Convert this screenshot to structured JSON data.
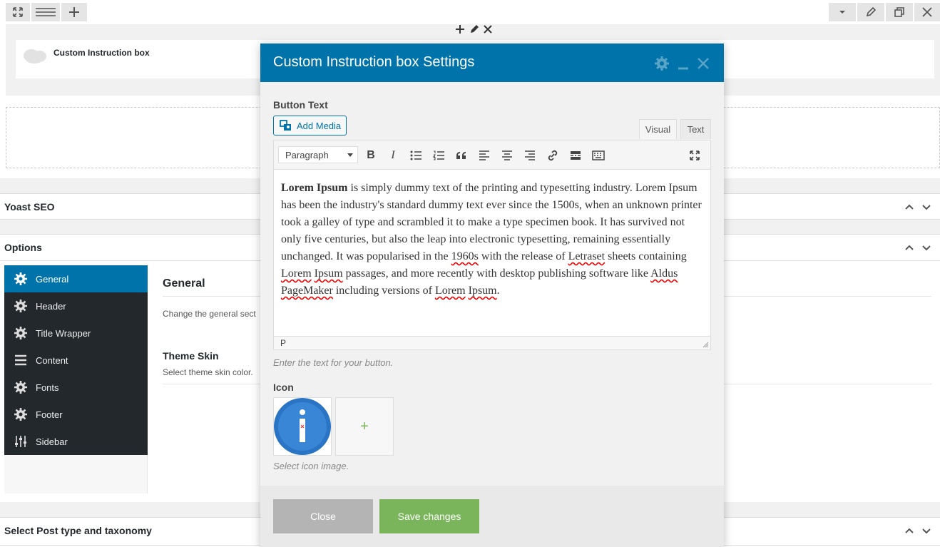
{
  "top_toolbar": {
    "left_buttons": [
      "expand-icon",
      "menu-icon",
      "plus-icon"
    ],
    "right_buttons": [
      "chevron-down-icon",
      "pencil-icon",
      "clone-icon",
      "close-icon"
    ]
  },
  "element": {
    "title": "Custom Instruction box"
  },
  "postboxes": {
    "yoast": "Yoast SEO",
    "options": "Options",
    "taxonomy": "Select Post type and taxonomy"
  },
  "options_panel": {
    "menu": [
      {
        "label": "General",
        "icon": "gear-icon",
        "active": true
      },
      {
        "label": "Header",
        "icon": "gear-icon"
      },
      {
        "label": "Title Wrapper",
        "icon": "gear-icon"
      },
      {
        "label": "Content",
        "icon": "list-icon"
      },
      {
        "label": "Fonts",
        "icon": "gear-icon"
      },
      {
        "label": "Footer",
        "icon": "gear-icon"
      },
      {
        "label": "Sidebar",
        "icon": "sliders-icon"
      }
    ],
    "section_title": "General",
    "section_desc": "Change the general sect",
    "skin_title": "Theme Skin",
    "skin_desc": "Select theme skin color."
  },
  "modal": {
    "title": "Custom Instruction box Settings",
    "button_text_label": "Button Text",
    "add_media": "Add Media",
    "tab_visual": "Visual",
    "tab_text": "Text",
    "format_select": "Paragraph",
    "editor": {
      "bold_lead": "Lorem Ipsum",
      "line1": " is simply dummy text of the printing and typesetting industry. Lorem Ipsum has been the industry's standard dummy text ever since the 1500s, when an unknown printer took a galley of type and scrambled it to make a type specimen book. It has survived not only five centuries, but also the leap into electronic typesetting, remaining essentially unchanged. It was popularised in the ",
      "w1960s": "1960s",
      "seg2": " with the release of ",
      "letraset": "Letraset",
      "seg3": " sheets containing ",
      "lorem1": "Lorem",
      "sp1": " ",
      "ipsum1": "Ipsum",
      "seg4": " passages, and more recently with desktop publishing software like ",
      "aldus": "Aldus",
      "sp2": " ",
      "pagemaker": "PageMaker",
      "seg5": " including versions of ",
      "lorem2": "Lorem",
      "sp3": " ",
      "ipsum2": "Ipsum",
      "seg6": "."
    },
    "status_path": "P",
    "button_text_hint": "Enter the text for your button.",
    "icon_label": "Icon",
    "icon_add": "+",
    "icon_hint": "Select icon image.",
    "close_button": "Close",
    "save_button": "Save changes"
  },
  "colors": {
    "primary": "#0073aa",
    "dark_sidebar": "#23282d",
    "save_green": "#7ab55c",
    "close_grey": "#b4b4b4"
  }
}
